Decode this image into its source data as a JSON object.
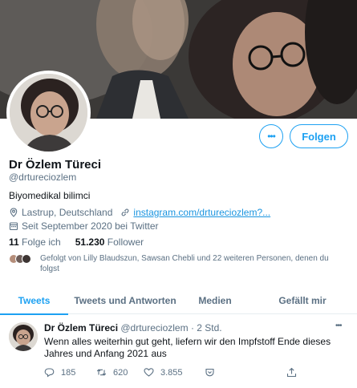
{
  "profile": {
    "name": "Dr Özlem Türeci",
    "handle": "@drtureciozlem",
    "bio": "Biyomedikal bilimci",
    "location": "Lastrup, Deutschland",
    "website": "instagram.com/drtureciozlem?...",
    "joined": "Seit September 2020 bei Twitter",
    "following_count": "11",
    "following_label": "Folge ich",
    "followers_count": "51.230",
    "followers_label": "Follower",
    "followed_by": "Gefolgt von Lilly Blaudszun, Sawsan Chebli und 22 weiteren Personen, denen du folgst"
  },
  "buttons": {
    "more": "•••",
    "follow": "Folgen"
  },
  "tabs": [
    "Tweets",
    "Tweets und Antworten",
    "Medien",
    "Gefällt mir"
  ],
  "tweet": {
    "author": "Dr Özlem Türeci",
    "handle": "@drtureciozlem",
    "time": "· 2 Std.",
    "more": "•••",
    "text": "Wenn alles weiterhin gut geht, liefern wir den Impfstoff Ende dieses Jahres und Anfang 2021 aus",
    "replies": "185",
    "retweets": "620",
    "likes": "3.855"
  },
  "colors": {
    "accent": "#1da1f2",
    "secondary_text": "#5b7083",
    "link": "#1b95e0"
  },
  "icons": [
    "location-icon",
    "link-icon",
    "calendar-icon",
    "reply-icon",
    "retweet-icon",
    "like-icon",
    "save-icon",
    "share-icon"
  ]
}
